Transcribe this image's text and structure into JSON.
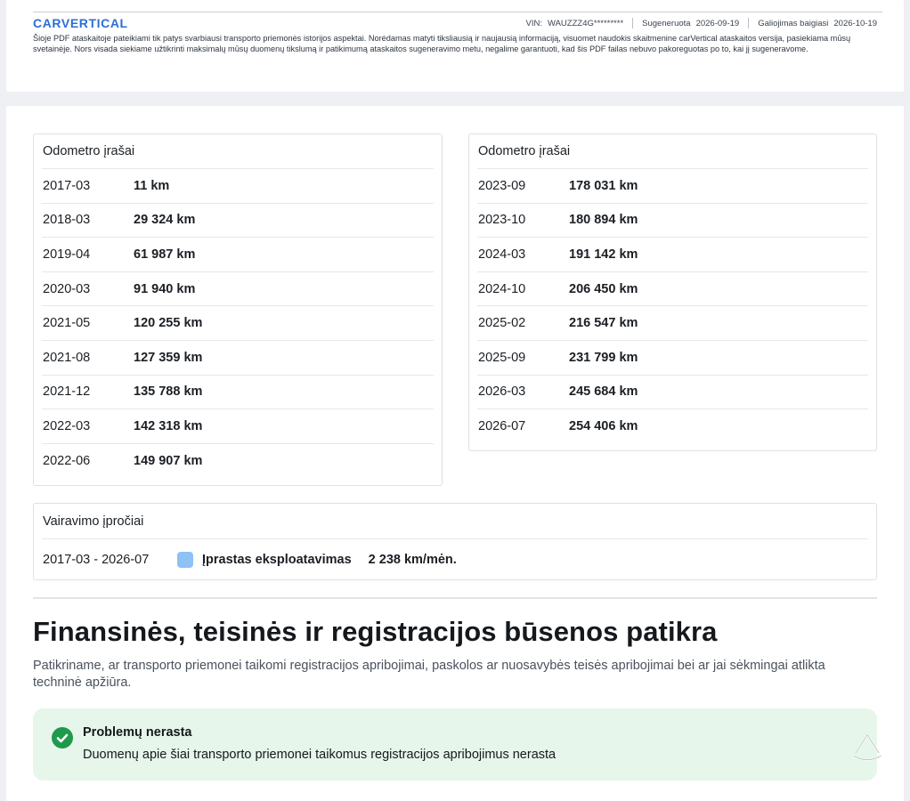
{
  "header": {
    "logo": "CARVERTICAL",
    "vin_label": "VIN:",
    "vin_value": "WAUZZZ4G*********",
    "generated_label": "Sugeneruota",
    "generated_value": "2026-09-19",
    "expires_label": "Galiojimas baigiasi",
    "expires_value": "2026-10-19",
    "disclaimer": "Šioje PDF ataskaitoje pateikiami tik patys svarbiausi transporto priemonės istorijos aspektai. Norėdamas matyti tiksliausią ir naujausią informaciją, visuomet naudokis skaitmenine carVertical ataskaitos versija, pasiekiama mūsų svetainėje. Nors visada siekiame užtikrinti maksimalų mūsų duomenų tikslumą ir patikimumą ataskaitos sugeneravimo metu, negalime garantuoti, kad šis PDF failas nebuvo pakoreguotas po to, kai jį sugeneravome."
  },
  "odometer_left": {
    "title": "Odometro įrašai",
    "rows": [
      {
        "date": "2017-03",
        "km": "11 km"
      },
      {
        "date": "2018-03",
        "km": "29 324 km"
      },
      {
        "date": "2019-04",
        "km": "61 987 km"
      },
      {
        "date": "2020-03",
        "km": "91 940 km"
      },
      {
        "date": "2021-05",
        "km": "120 255 km"
      },
      {
        "date": "2021-08",
        "km": "127 359 km"
      },
      {
        "date": "2021-12",
        "km": "135 788 km"
      },
      {
        "date": "2022-03",
        "km": "142 318 km"
      },
      {
        "date": "2022-06",
        "km": "149 907 km"
      }
    ]
  },
  "odometer_right": {
    "title": "Odometro įrašai",
    "rows": [
      {
        "date": "2023-09",
        "km": "178 031 km"
      },
      {
        "date": "2023-10",
        "km": "180 894 km"
      },
      {
        "date": "2024-03",
        "km": "191 142 km"
      },
      {
        "date": "2024-10",
        "km": "206 450 km"
      },
      {
        "date": "2025-02",
        "km": "216 547 km"
      },
      {
        "date": "2025-09",
        "km": "231 799 km"
      },
      {
        "date": "2026-03",
        "km": "245 684 km"
      },
      {
        "date": "2026-07",
        "km": "254 406 km"
      }
    ]
  },
  "driving_habits": {
    "title": "Vairavimo įpročiai",
    "range": "2017-03 - 2026-07",
    "usage": "Įprastas eksploatavimas",
    "rate": "2 238 km/mėn.",
    "swatch_color": "#8ec1f5"
  },
  "legal_section": {
    "title": "Finansinės, teisinės ir registracijos būsenos patikra",
    "description": "Patikriname, ar transporto priemonei taikomi registracijos apribojimai, paskolos ar nuosavybės teisės apribojimai bei ar jai sėkmingai atlikta techninė apžiūra.",
    "status_title": "Problemų nerasta",
    "status_text": "Duomenų apie šiai transporto priemonei taikomus registracijos apribojimus nerasta",
    "status_color": "#1f9a4c"
  },
  "icons": [
    "check-circle-icon",
    "watermark-logo-icon"
  ]
}
